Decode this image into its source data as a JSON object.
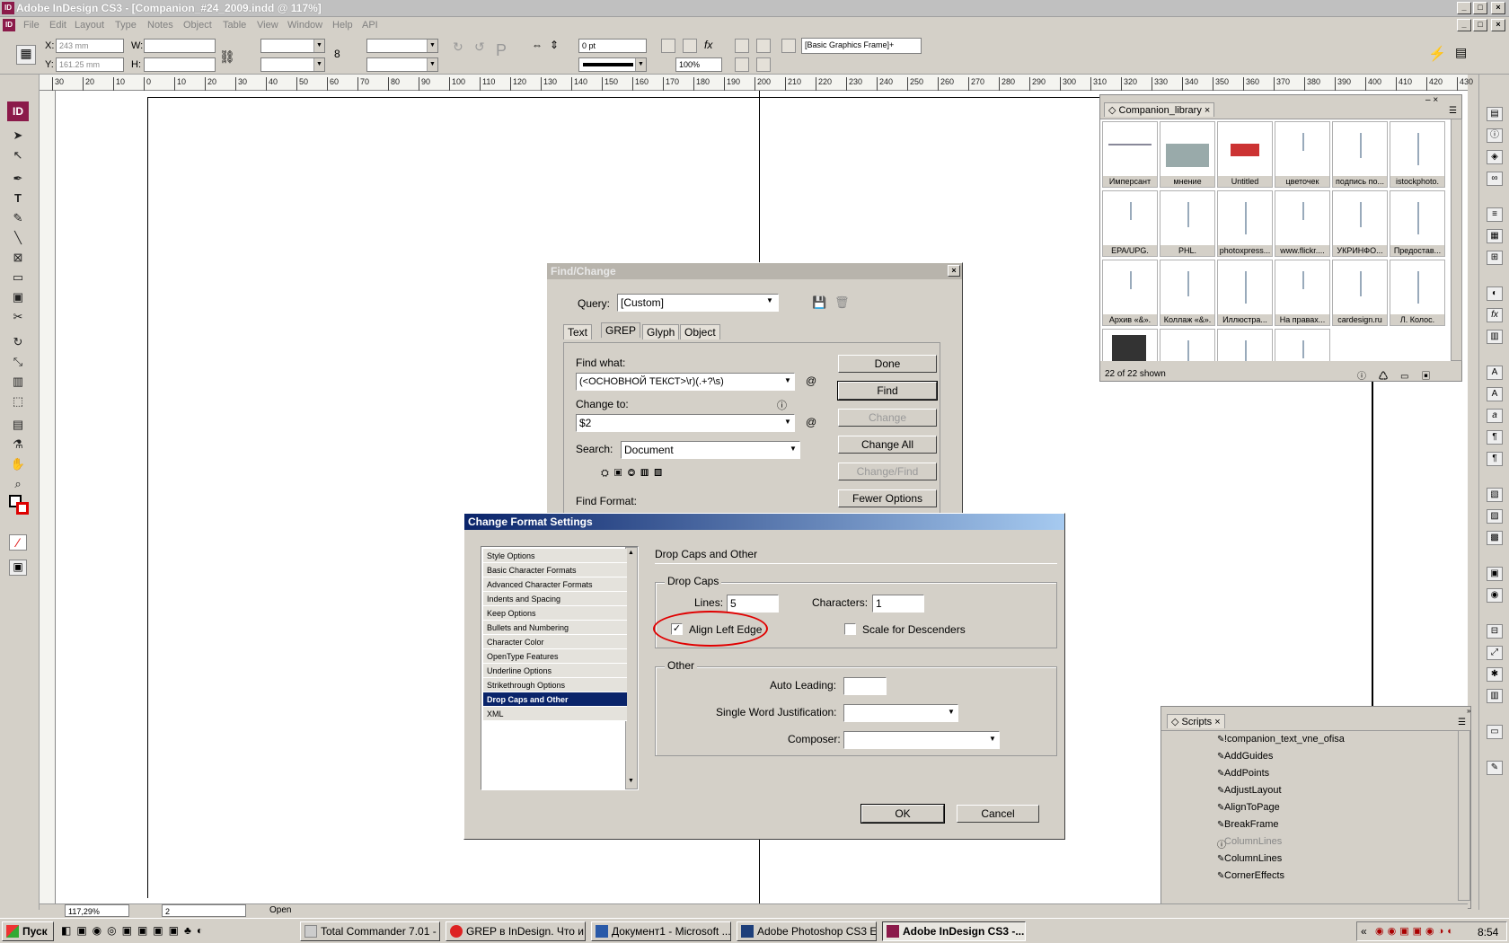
{
  "app": {
    "title": "Adobe InDesign CS3 - [Companion_#24_2009.indd @ 117%]",
    "logo": "ID"
  },
  "menu": [
    "File",
    "Edit",
    "Layout",
    "Type",
    "Notes",
    "Object",
    "Table",
    "View",
    "Window",
    "Help",
    "API"
  ],
  "control": {
    "x_label": "X:",
    "x_value": "243 mm",
    "y_label": "Y:",
    "y_value": "161.25 mm",
    "w_label": "W:",
    "h_label": "H:",
    "stroke_value": "0 pt",
    "zoom_value": "100%",
    "frame_style": "[Basic Graphics Frame]+"
  },
  "ruler_ticks": [
    "30",
    "20",
    "10",
    "0",
    "10",
    "20",
    "30",
    "40",
    "50",
    "60",
    "70",
    "80",
    "90",
    "100",
    "110",
    "120",
    "130",
    "140",
    "150",
    "160",
    "170",
    "180",
    "190",
    "200",
    "210",
    "220",
    "230",
    "240",
    "250",
    "260",
    "270",
    "280",
    "290",
    "300",
    "310",
    "320",
    "330",
    "340",
    "350",
    "360",
    "370",
    "380",
    "390",
    "400",
    "410",
    "420",
    "430"
  ],
  "library": {
    "tab": "Companion_library",
    "items": [
      "Имперсант",
      "мнение",
      "Untitled",
      "цветочек",
      "подпись по...",
      "istockphoto.",
      "EPA/UPG.",
      "PHL.",
      "photoxpress...",
      "www.flickr....",
      "УКРИНФО...",
      "Предостав...",
      "Архив «&».",
      "Коллаж «&».",
      "Иллюстра...",
      "На правах...",
      "cardesign.ru",
      "Л. Колос.",
      "",
      "",
      "",
      ""
    ],
    "status": "22 of 22 shown"
  },
  "find_change": {
    "title": "Find/Change",
    "query_label": "Query:",
    "query_value": "[Custom]",
    "tabs": [
      "Text",
      "GREP",
      "Glyph",
      "Object"
    ],
    "find_what_label": "Find what:",
    "find_what_value": "(<ОСНОВНОЙ ТЕКСТ>\\r)(.+?\\s)",
    "change_to_label": "Change to:",
    "change_to_value": "$2",
    "search_label": "Search:",
    "search_value": "Document",
    "find_format_label": "Find Format:",
    "buttons": {
      "done": "Done",
      "find": "Find",
      "change": "Change",
      "change_all": "Change All",
      "change_find": "Change/Find",
      "fewer": "Fewer Options"
    }
  },
  "format_settings": {
    "title": "Change Format Settings",
    "categories": [
      "Style Options",
      "Basic Character Formats",
      "Advanced Character Formats",
      "Indents and Spacing",
      "Keep Options",
      "Bullets and Numbering",
      "Character Color",
      "OpenType Features",
      "Underline Options",
      "Strikethrough Options",
      "Drop Caps and Other",
      "XML"
    ],
    "selected_index": 10,
    "section_title": "Drop Caps and Other",
    "drop_caps_group": "Drop Caps",
    "lines_label": "Lines:",
    "lines_value": "5",
    "characters_label": "Characters:",
    "characters_value": "1",
    "align_left_label": "Align Left Edge",
    "align_left_checked": "✓",
    "scale_desc_label": "Scale for Descenders",
    "other_group": "Other",
    "auto_leading_label": "Auto Leading:",
    "swj_label": "Single Word Justification:",
    "composer_label": "Composer:",
    "ok": "OK",
    "cancel": "Cancel",
    "highlight_color": "#e00000"
  },
  "scripts": {
    "tab": "Scripts",
    "items": [
      {
        "name": "!companion_text_vne_ofisa",
        "icon": "script-icon",
        "dim": false
      },
      {
        "name": "AddGuides",
        "icon": "script-icon",
        "dim": false
      },
      {
        "name": "AddPoints",
        "icon": "script-icon",
        "dim": false
      },
      {
        "name": "AdjustLayout",
        "icon": "script-icon",
        "dim": false
      },
      {
        "name": "AlignToPage",
        "icon": "script-icon",
        "dim": false
      },
      {
        "name": "BreakFrame",
        "icon": "script-icon",
        "dim": false
      },
      {
        "name": "ColumnLines",
        "icon": "info-icon",
        "dim": true
      },
      {
        "name": "ColumnLines",
        "icon": "script-icon",
        "dim": false
      },
      {
        "name": "CornerEffects",
        "icon": "script-icon",
        "dim": false
      }
    ]
  },
  "status": {
    "zoom": "117,29%",
    "page": "2",
    "state": "Open"
  },
  "taskbar": {
    "start": "Пуск",
    "tasks": [
      "Total Commander 7.01 - ...",
      "GREP в InDesign. Что и ...",
      "Документ1 - Microsoft ...",
      "Adobe Photoshop CS3 E...",
      "Adobe InDesign CS3 -..."
    ],
    "active_index": 4,
    "lang": "«",
    "time": "8:54"
  }
}
